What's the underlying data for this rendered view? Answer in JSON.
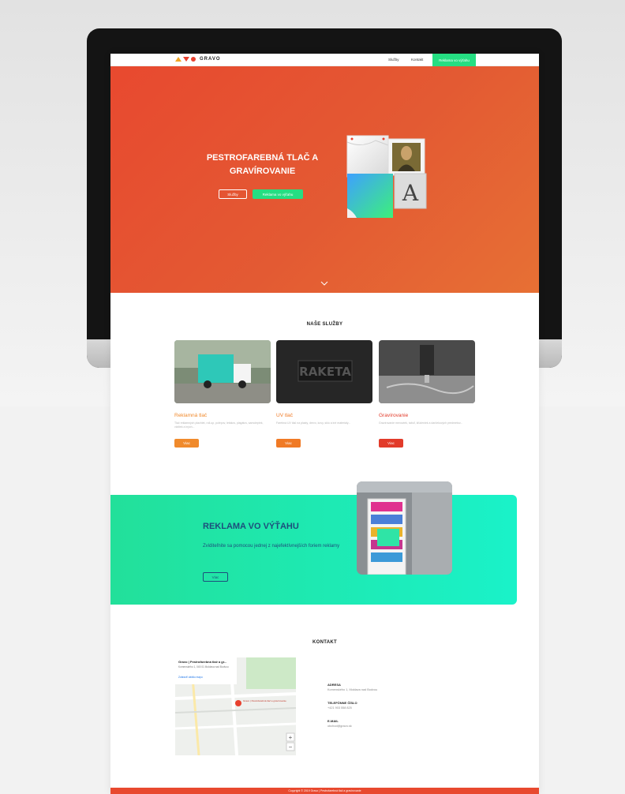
{
  "nav": {
    "brand": "GRAVO",
    "links": [
      "Služby",
      "Kontakt"
    ],
    "cta": "Reklama vo výťahu"
  },
  "hero": {
    "title": "PESTROFAREBNÁ TLAČ A GRAVÍROVANIE",
    "btn_services": "Služby",
    "btn_lift": "Reklama vo výťahu",
    "art_letter": "A"
  },
  "services": {
    "title": "NAŠE SLUŽBY",
    "cards": [
      {
        "title": "Reklamná tlač",
        "text": "Tlač reklamných plachiet, roll-up, polepov, letákov, plagátov, samolepiek, vizitiek a iných...",
        "btn": "Viac",
        "color": "#f08a2c"
      },
      {
        "title": "UV tlač",
        "text": "Farebná UV tlač na plasty, drevo, kovy, sklo a iné materiály...",
        "btn": "Viac",
        "color": "#f07a25"
      },
      {
        "title": "Gravírovanie",
        "text": "Gravírovanie menoviek, tabúľ, kľúčeniek a darčekových predmetov...",
        "btn": "Viac",
        "color": "#e23b2a"
      }
    ]
  },
  "lift": {
    "title": "REKLAMA VO VÝŤAHU",
    "text": "Zviditeľnite sa pomocou jednej z najefektívnejších foriem reklamy",
    "btn": "Viac"
  },
  "contact": {
    "title": "KONTAKT",
    "map_place": "Gravo | Pestrofarebná tlač a gr...",
    "map_addr": "Komenského 1, 045 01 Moldava nad Bodvou",
    "map_link": "Zobraziť väčšiu mapu",
    "map_pin_label": "Gravo | Pestrofarebná tlač a gravírovanie",
    "address_label": "ADRESA",
    "address": "Komenského 1, Moldava nad Bodvou",
    "phone_label": "TELEFÓNNE ČÍSLO",
    "phone": "+421 903 558 825",
    "email_label": "E-MAIL",
    "email": "obchod@gravo.sk"
  },
  "footer": {
    "text": "Copyright © 2019 Gravo | Pestrofarebná tlač a gravírovanie"
  }
}
